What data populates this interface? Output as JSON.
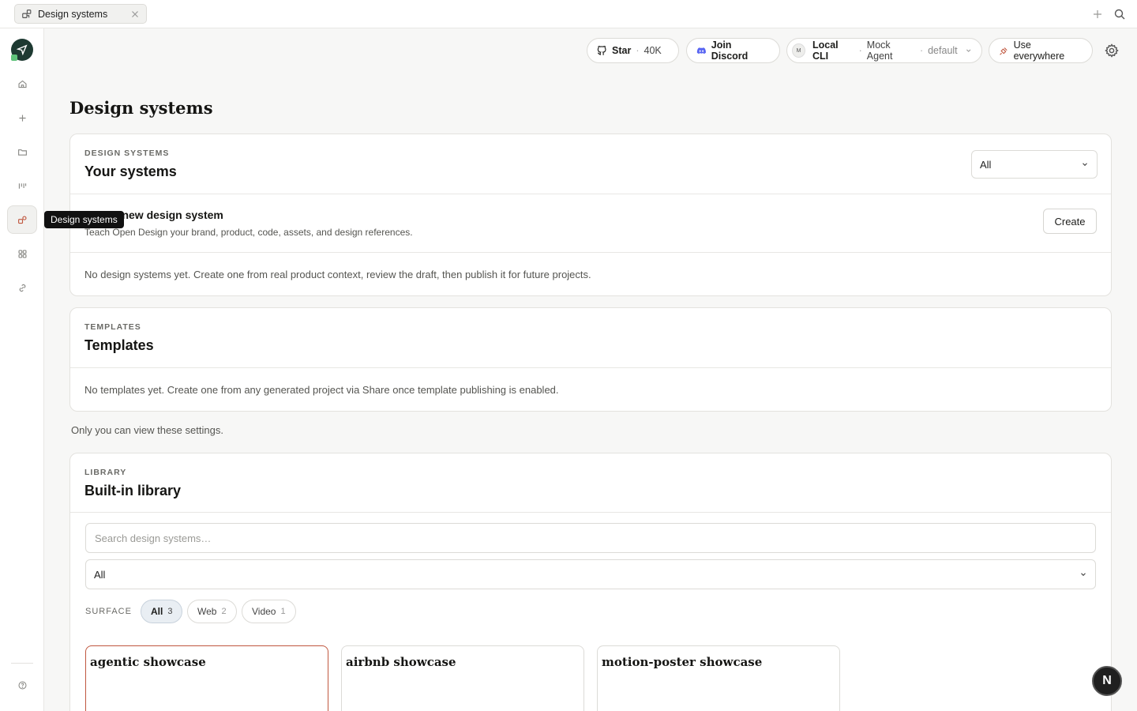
{
  "tab": {
    "label": "Design systems"
  },
  "rail": {
    "tooltip": "Design systems"
  },
  "header": {
    "star_label": "Star",
    "star_count": "40K",
    "discord_label": "Join Discord",
    "cli_avatar": "M",
    "cli_label": "Local CLI",
    "agent_label": "Mock Agent",
    "agent_profile": "default",
    "use_everywhere_label": "Use everywhere"
  },
  "page": {
    "title": "Design systems"
  },
  "your_systems": {
    "eyebrow": "DESIGN SYSTEMS",
    "heading": "Your systems",
    "filter_value": "All",
    "create_title": "Create new design system",
    "create_desc": "Teach Open Design your brand, product, code, assets, and design references.",
    "create_button": "Create",
    "empty_text": "No design systems yet. Create one from real product context, review the draft, then publish it for future projects."
  },
  "templates": {
    "eyebrow": "TEMPLATES",
    "heading": "Templates",
    "empty_text": "No templates yet. Create one from any generated project via Share once template publishing is enabled."
  },
  "privacy_note": "Only you can view these settings.",
  "library": {
    "eyebrow": "LIBRARY",
    "heading": "Built-in library",
    "search_placeholder": "Search design systems…",
    "filter_value": "All",
    "surface_label": "SURFACE",
    "chips": [
      {
        "label": "All",
        "count": "3"
      },
      {
        "label": "Web",
        "count": "2"
      },
      {
        "label": "Video",
        "count": "1"
      }
    ],
    "cards": [
      {
        "title": "agentic showcase"
      },
      {
        "title": "airbnb showcase"
      },
      {
        "title": "motion-poster showcase"
      }
    ]
  },
  "fab_label": "N",
  "colors": {
    "accent": "#c0573f",
    "brand_dark": "#1e3a32",
    "discord": "#5865f2"
  }
}
